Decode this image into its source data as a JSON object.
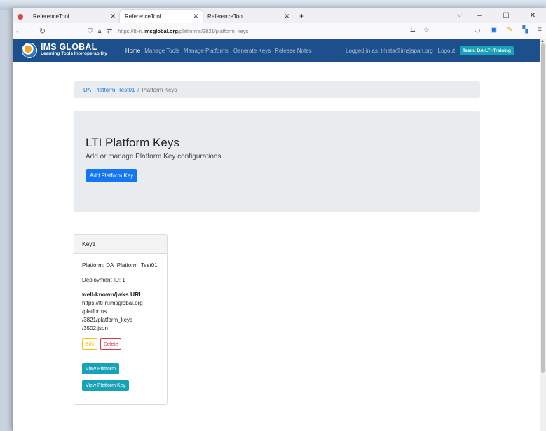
{
  "browser": {
    "tabs": [
      {
        "title": "ReferenceTool",
        "favicon_color": "#e0463e"
      },
      {
        "title": "ReferenceTool",
        "favicon_color": "#ffffff"
      },
      {
        "title": "ReferenceTool",
        "favicon_color": "#ffffff"
      }
    ],
    "new_tab_label": "+",
    "url_prefix": "https://lti-ri.",
    "url_domain": "imsglobal.org",
    "url_path": "/platforms/3821/platform_keys",
    "window_controls": {
      "list_tabs": "⌵",
      "minimize": "–",
      "maximize": "☐",
      "close": "✕"
    }
  },
  "site": {
    "logo_line1": "IMS GLOBAL",
    "logo_line2": "Learning Tools Interoperability",
    "nav": [
      "Home",
      "Manage Tools",
      "Manage Platforms",
      "Generate Keys",
      "Release Notes"
    ],
    "logged_in": "Logged in as: t-hata@imsjapan.org",
    "logout": "Logout",
    "team_badge": "Team: DA-LTI-Training",
    "nav_color": "#1c4f8c"
  },
  "breadcrumb": {
    "link": "DA_Platform_Test01",
    "separator": "/",
    "current": "Platform Keys"
  },
  "jumbotron": {
    "title": "LTI Platform Keys",
    "subtitle": "Add or manage Platform Key configurations.",
    "add_button": "Add Platform Key"
  },
  "key_card": {
    "header": "Key1",
    "platform": "Platform: DA_Platform_Test01",
    "deployment": "Deployment ID: 1",
    "jwks_title": "well-known/jwks URL",
    "jwks_lines": [
      "https://lti-ri.imsglobal.org",
      "/platforms",
      "/3821/platform_keys",
      "/3502.json"
    ],
    "edit": "Edit",
    "delete": "Delete",
    "view_platform": "View Platform",
    "view_platform_key": "View Platform Key"
  }
}
